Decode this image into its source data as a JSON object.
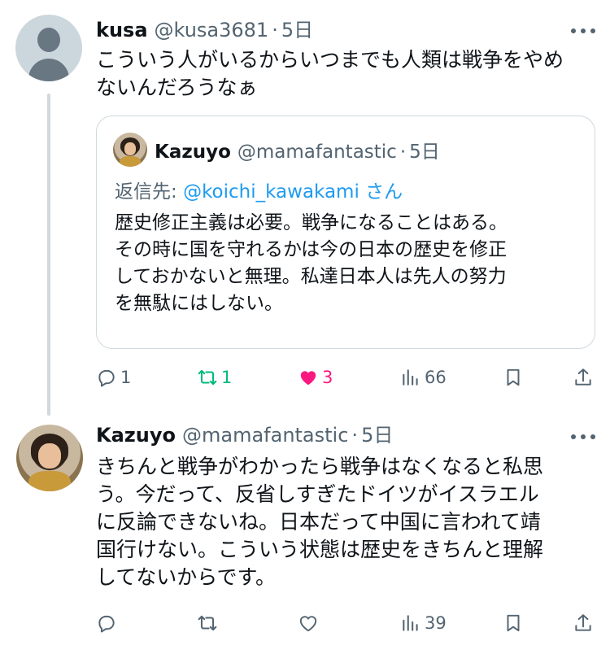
{
  "tweets": [
    {
      "author_name": "kusa",
      "author_handle": "@kusa3681",
      "separator": "·",
      "time": "5日",
      "text": "こういう人がいるからいつまでも人類は戦争をやめ\nないんだろうなぁ",
      "quote": {
        "author_name": "Kazuyo",
        "author_handle": "@mamafantastic",
        "separator": "·",
        "time": "5日",
        "reply_prefix": "返信先: ",
        "reply_mention": "@koichi_kawakami",
        "reply_suffix": " さん",
        "text": "歴史修正主義は必要。戦争になることはある。\nその時に国を守れるかは今の日本の歴史を修正\nしておかないと無理。私達日本人は先人の努力\nを無駄にはしない。"
      },
      "actions": {
        "reply_count": "1",
        "retweet_count": "1",
        "like_count": "3",
        "view_count": "66"
      }
    },
    {
      "author_name": "Kazuyo",
      "author_handle": "@mamafantastic",
      "separator": "·",
      "time": "5日",
      "text": "きちんと戦争がわかったら戦争はなくなると私思\nう。今だって、反省しすぎたドイツがイスラエル\nに反論できないね。日本だって中国に言われて靖\n国行けない。こういう状態は歴史をきちんと理解\nしてないからです。",
      "actions": {
        "reply_count": "",
        "retweet_count": "",
        "like_count": "",
        "view_count": "39"
      }
    }
  ],
  "colors": {
    "text_primary": "#0f1419",
    "text_secondary": "#536471",
    "link": "#1d9bf0",
    "retweet_active": "#00ba7c",
    "like_active": "#f91880",
    "border": "#cfd9de"
  },
  "icons": [
    "more-icon",
    "reply-icon",
    "retweet-icon",
    "like-icon",
    "views-icon",
    "bookmark-icon",
    "share-icon"
  ]
}
